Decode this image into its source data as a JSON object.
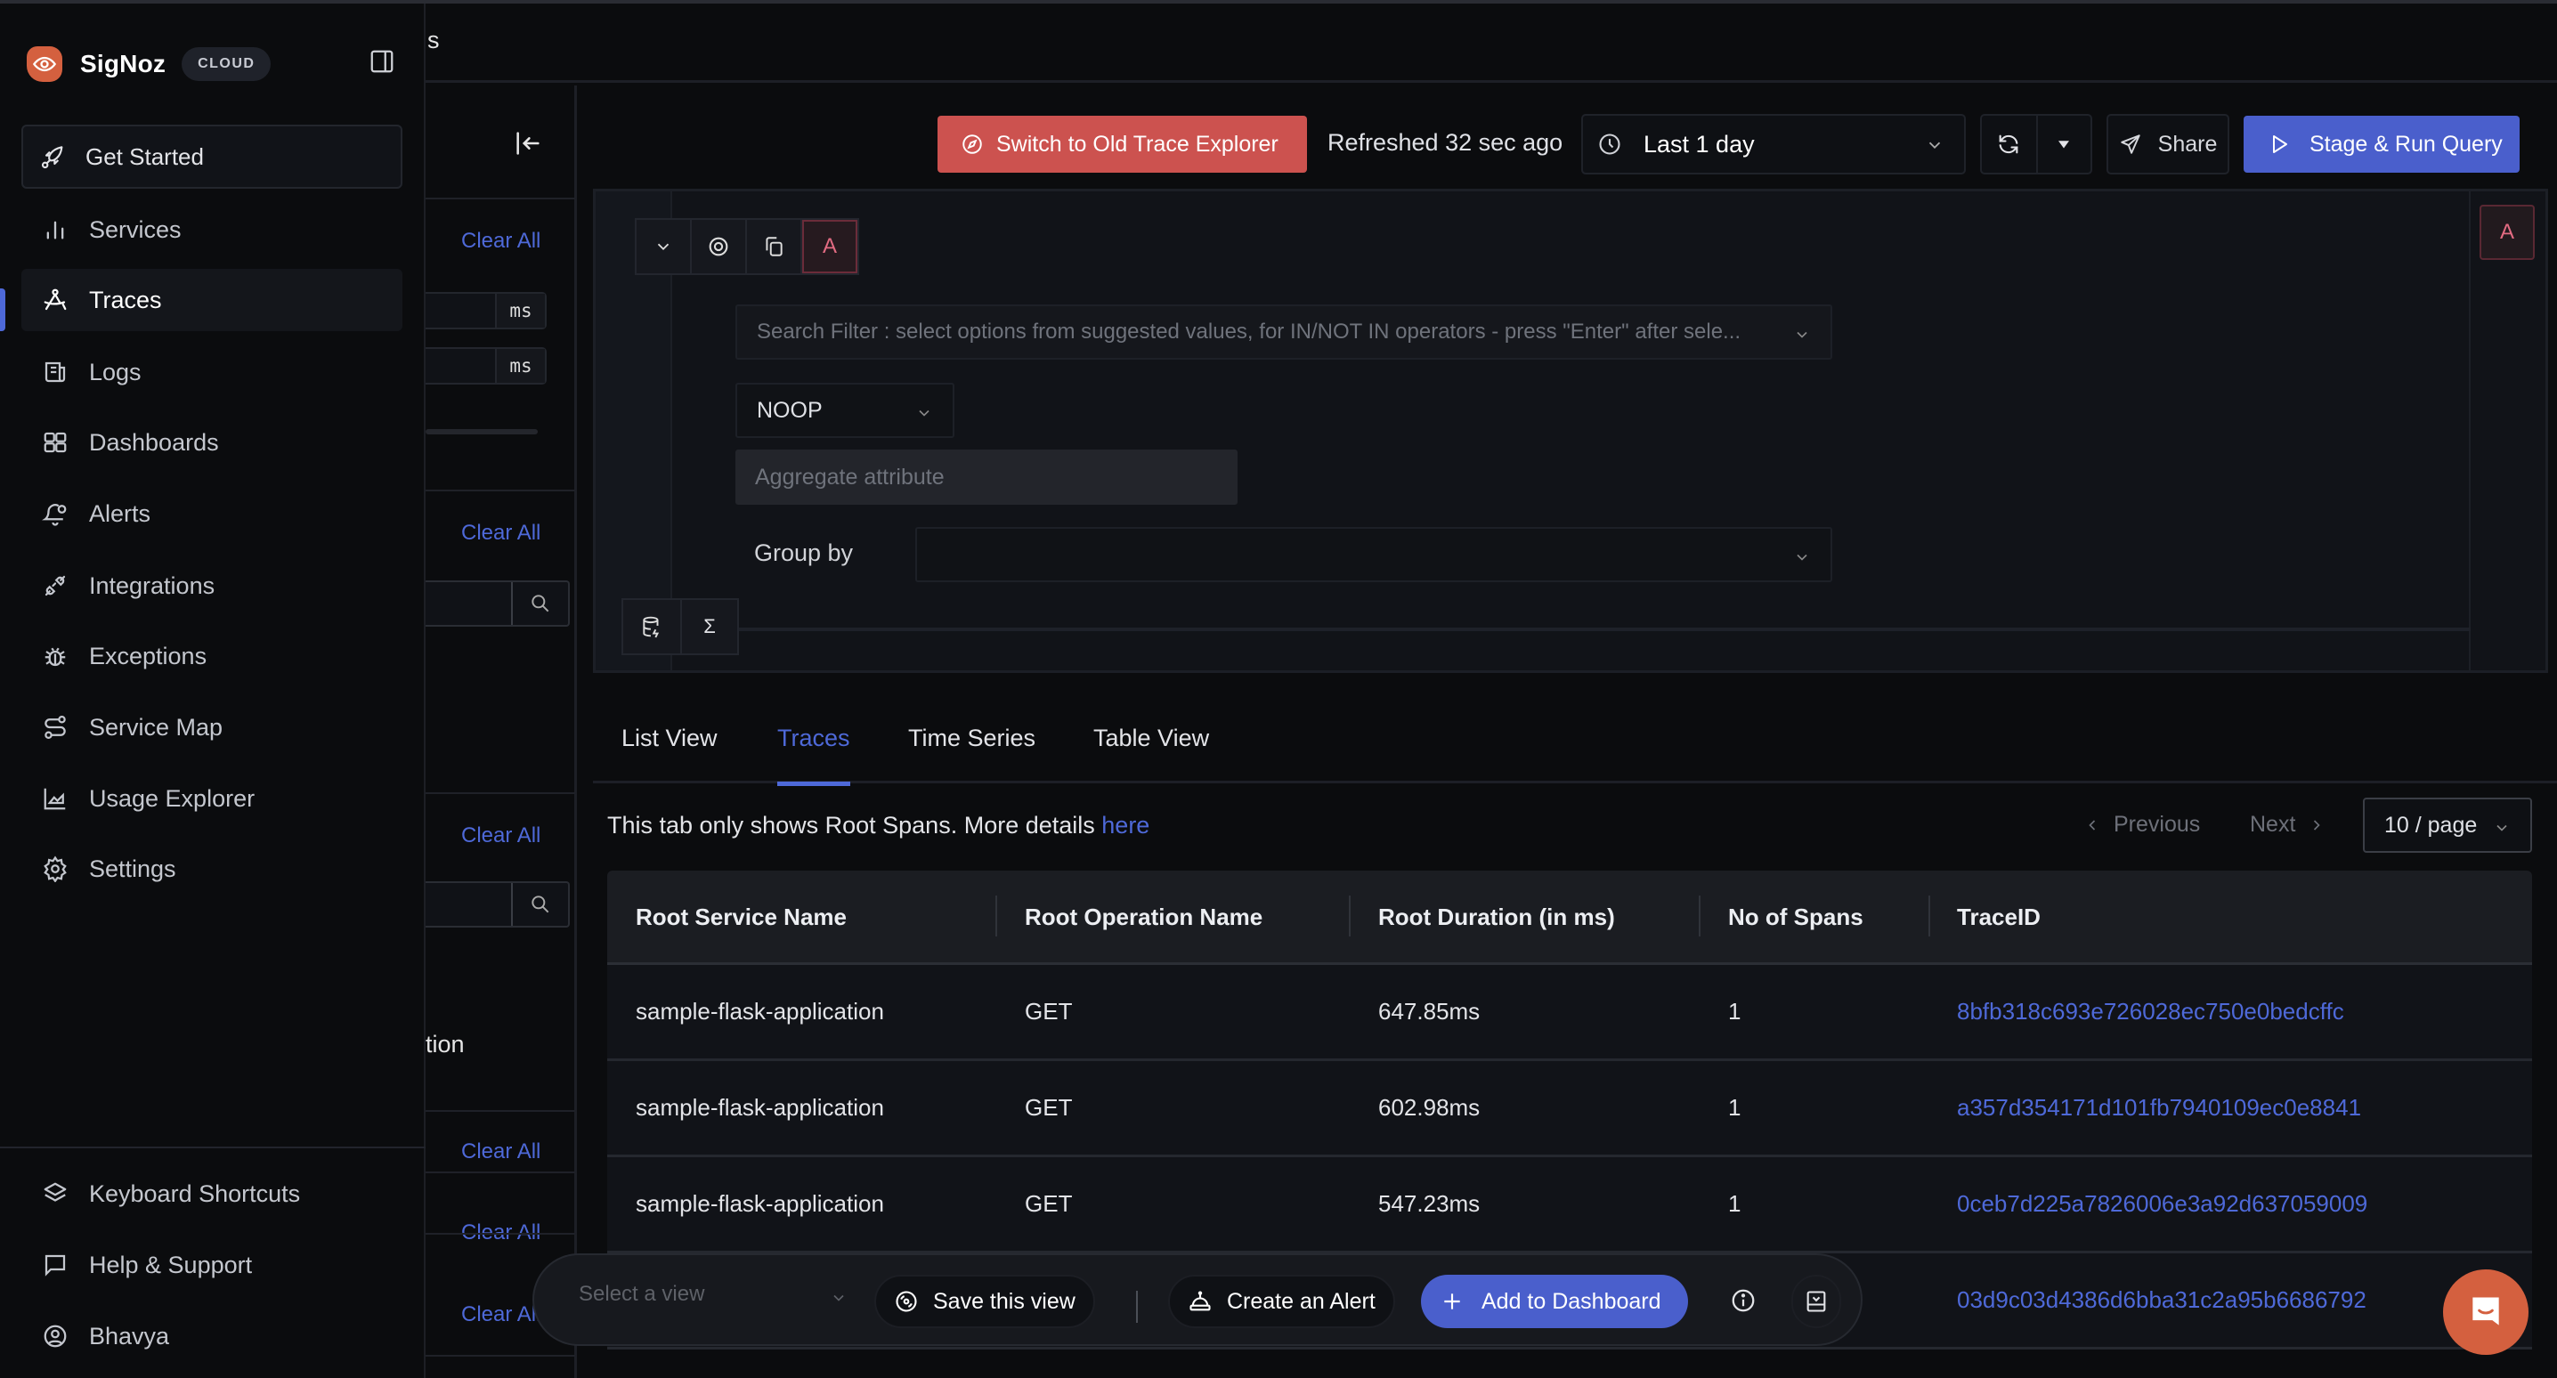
{
  "sidebar": {
    "brand": "SigNoz",
    "badge": "CLOUD",
    "get_started": "Get Started",
    "items": [
      {
        "label": "Services",
        "icon": "bar-chart-icon"
      },
      {
        "label": "Traces",
        "icon": "traces-icon",
        "active": true
      },
      {
        "label": "Logs",
        "icon": "logs-scroll-icon"
      },
      {
        "label": "Dashboards",
        "icon": "grid-icon"
      },
      {
        "label": "Alerts",
        "icon": "bell-icon"
      },
      {
        "label": "Integrations",
        "icon": "plug-icon"
      },
      {
        "label": "Exceptions",
        "icon": "bug-icon"
      },
      {
        "label": "Service Map",
        "icon": "route-icon"
      },
      {
        "label": "Usage Explorer",
        "icon": "area-chart-icon"
      },
      {
        "label": "Settings",
        "icon": "gear-icon"
      }
    ],
    "bottom_items": [
      {
        "label": "Keyboard Shortcuts",
        "icon": "layers-icon"
      },
      {
        "label": "Help & Support",
        "icon": "message-square-icon"
      },
      {
        "label": "Bhavya",
        "icon": "user-circle-icon"
      }
    ]
  },
  "header": {
    "partial_title": "s"
  },
  "filter_panel": {
    "clear_all": "Clear All",
    "duration_unit": "ms",
    "partial_label": "tion"
  },
  "toolbar": {
    "switch_old": "Switch to Old Trace Explorer",
    "refreshed": "Refreshed 32 sec ago",
    "time_range": "Last 1 day",
    "share": "Share",
    "run": "Stage & Run Query"
  },
  "query": {
    "label": "A",
    "search_placeholder": "Search Filter : select options from suggested values, for IN/NOT IN operators - press \"Enter\" after sele...",
    "aggregate_operator": "NOOP",
    "aggregate_attribute_placeholder": "Aggregate attribute",
    "group_by_label": "Group by",
    "sigma": "Σ"
  },
  "tabs": [
    {
      "label": "List View",
      "active": false
    },
    {
      "label": "Traces",
      "active": true
    },
    {
      "label": "Time Series",
      "active": false
    },
    {
      "label": "Table View",
      "active": false
    }
  ],
  "info": {
    "text": "This tab only shows Root Spans. More details ",
    "link": "here"
  },
  "pagination": {
    "previous": "Previous",
    "next": "Next",
    "page_size": "10 / page"
  },
  "table": {
    "columns": [
      "Root Service Name",
      "Root Operation Name",
      "Root Duration (in ms)",
      "No of Spans",
      "TraceID"
    ],
    "rows": [
      [
        "sample-flask-application",
        "GET",
        "647.85ms",
        "1",
        "8bfb318c693e726028ec750e0bedcffc"
      ],
      [
        "sample-flask-application",
        "GET",
        "602.98ms",
        "1",
        "a357d354171d101fb7940109ec0e8841"
      ],
      [
        "sample-flask-application",
        "GET",
        "547.23ms",
        "1",
        "0ceb7d225a7826006e3a92d637059009"
      ],
      [
        "",
        "",
        "",
        "",
        "03d9c03d4386d6bba31c2a95b6686792"
      ]
    ]
  },
  "float_bar": {
    "select_view_placeholder": "Select a view",
    "save_view": "Save this view",
    "create_alert": "Create an Alert",
    "add_dashboard": "Add to Dashboard"
  },
  "colors": {
    "accent": "#4e69d8",
    "danger_button": "#cc524f",
    "brand": "#d4603f",
    "query_label": "#e26b82"
  }
}
